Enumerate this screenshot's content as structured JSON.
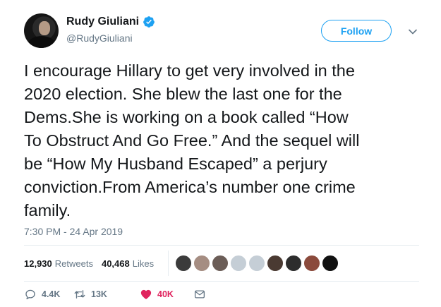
{
  "user": {
    "display_name": "Rudy Giuliani",
    "handle": "@RudyGiuliani",
    "verified": true
  },
  "follow_label": "Follow",
  "tweet": {
    "text": "I encourage Hillary to get very involved in the\n2020 election. She blew the last one for the\nDems.She is working on a book called “How\nTo Obstruct And Go Free.” And the sequel will\nbe “How My Husband Escaped” a perjury\nconviction.From America’s number one crime\nfamily.",
    "timestamp": "7:30 PM - 24 Apr 2019"
  },
  "stats": {
    "retweets_count": "12,930",
    "retweets_label": "Retweets",
    "likes_count": "40,468",
    "likes_label": "Likes"
  },
  "likers": [
    {
      "name": "liker-avatar-1",
      "color": "#3b3b3b"
    },
    {
      "name": "liker-avatar-2",
      "color": "#a58d82"
    },
    {
      "name": "liker-avatar-3",
      "color": "#6b5d57"
    },
    {
      "name": "liker-avatar-4",
      "color": "#c5ced6"
    },
    {
      "name": "liker-avatar-5",
      "color": "#c5ced6"
    },
    {
      "name": "liker-avatar-6",
      "color": "#4a3a32"
    },
    {
      "name": "liker-avatar-7",
      "color": "#2d2d2d"
    },
    {
      "name": "liker-avatar-8",
      "color": "#8b4a3c"
    },
    {
      "name": "liker-avatar-9",
      "color": "#111111"
    }
  ],
  "actions": {
    "replies": "4.4K",
    "retweets": "13K",
    "likes": "40K"
  },
  "colors": {
    "accent": "#1da1f2",
    "like": "#e0245e",
    "muted": "#657786"
  }
}
